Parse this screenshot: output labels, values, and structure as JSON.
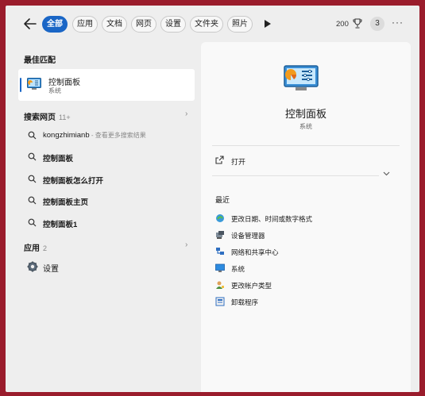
{
  "tabs": [
    {
      "label": "全部",
      "active": true
    },
    {
      "label": "应用"
    },
    {
      "label": "文档"
    },
    {
      "label": "网页"
    },
    {
      "label": "设置"
    },
    {
      "label": "文件夹"
    },
    {
      "label": "照片"
    }
  ],
  "header": {
    "points": "200",
    "badge": "3",
    "more": "···"
  },
  "best_match": {
    "section_title": "最佳匹配",
    "title": "控制面板",
    "subtitle": "系统"
  },
  "web_search": {
    "section_title": "搜索网页",
    "count": "11+",
    "items": [
      {
        "text": "kongzhimianb",
        "hint": " - 查看更多搜索结果"
      },
      {
        "text": "控制面板"
      },
      {
        "text": "控制面板怎么打开"
      },
      {
        "text": "控制面板主页"
      },
      {
        "text": "控制面板1"
      }
    ]
  },
  "apps": {
    "section_title": "应用",
    "count": "2",
    "items": [
      {
        "label": "设置"
      }
    ]
  },
  "detail": {
    "name": "控制面板",
    "type": "系统",
    "open_label": "打开",
    "recent_title": "最近",
    "recent": [
      {
        "label": "更改日期、时间或数字格式",
        "icon": "date-time-icon"
      },
      {
        "label": "设备管理器",
        "icon": "device-manager-icon"
      },
      {
        "label": "网络和共享中心",
        "icon": "network-icon"
      },
      {
        "label": "系统",
        "icon": "system-icon"
      },
      {
        "label": "更改帐户类型",
        "icon": "account-icon"
      },
      {
        "label": "卸载程序",
        "icon": "uninstall-icon"
      }
    ]
  },
  "colors": {
    "accent": "#1a66c6",
    "frame": "#9a1c2c"
  }
}
